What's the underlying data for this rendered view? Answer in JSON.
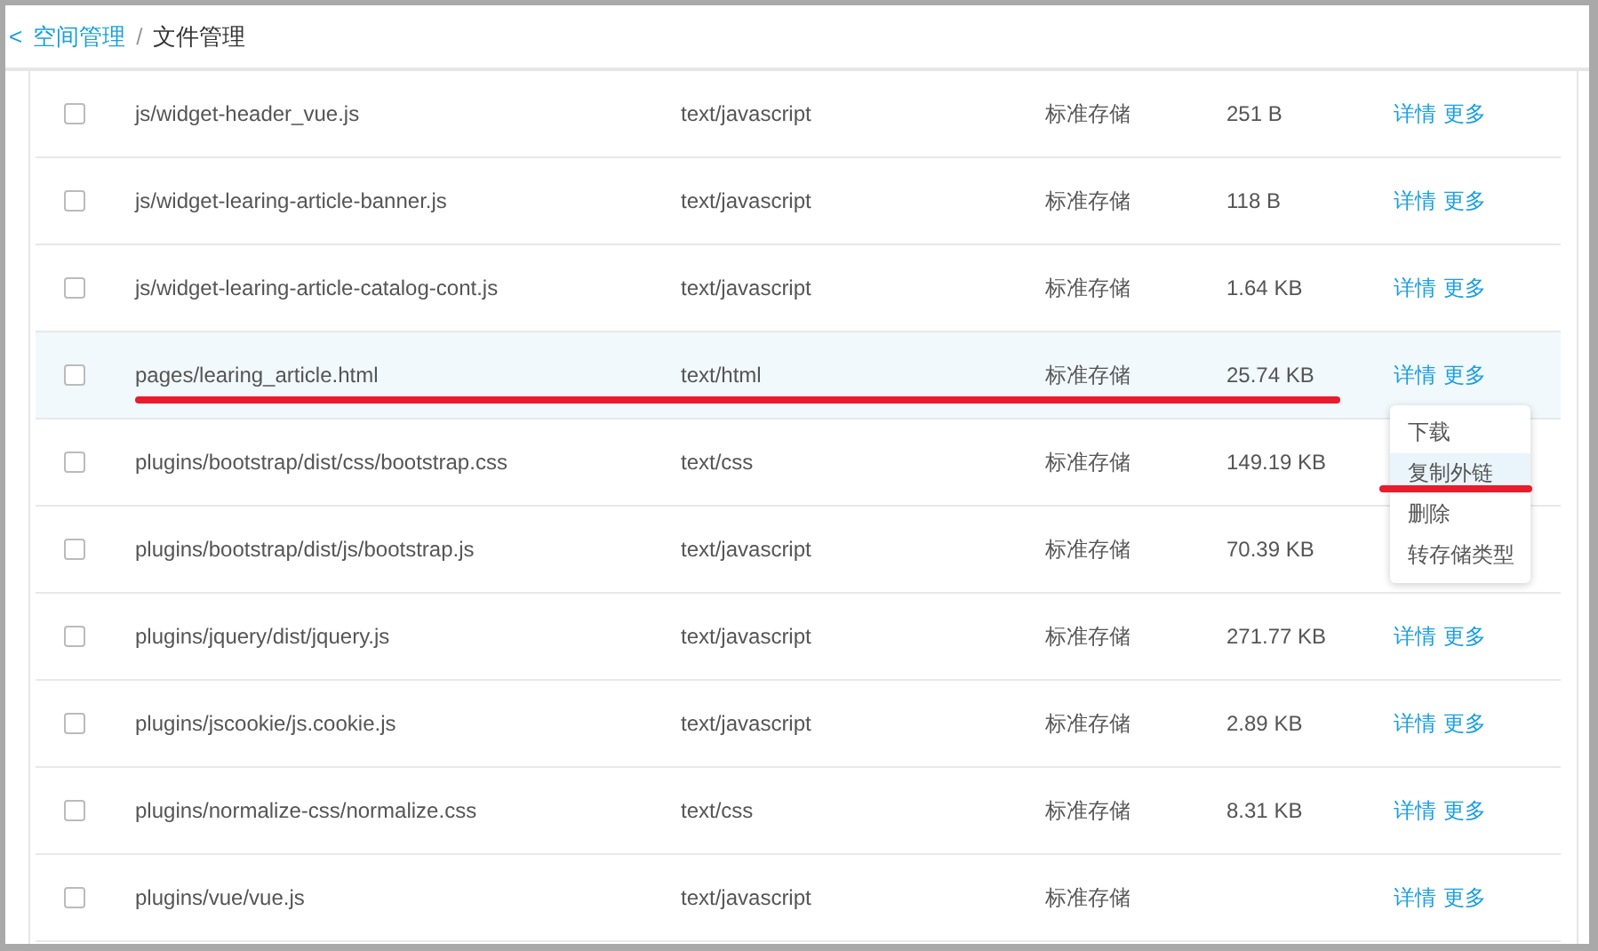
{
  "breadcrumb": {
    "back": "<",
    "items": [
      {
        "label": "空间管理",
        "link": true
      },
      {
        "label": "文件管理",
        "link": false
      }
    ],
    "separator": "/"
  },
  "rows": [
    {
      "checked": false,
      "selected": false,
      "underlined": false,
      "name": "js/widget-header_vue.js",
      "type": "text/javascript",
      "storage": "标准存储",
      "size": "251 B",
      "actions": [
        "详情",
        "更多"
      ]
    },
    {
      "checked": false,
      "selected": false,
      "underlined": false,
      "name": "js/widget-learing-article-banner.js",
      "type": "text/javascript",
      "storage": "标准存储",
      "size": "118 B",
      "actions": [
        "详情",
        "更多"
      ]
    },
    {
      "checked": false,
      "selected": false,
      "underlined": false,
      "name": "js/widget-learing-article-catalog-cont.js",
      "type": "text/javascript",
      "storage": "标准存储",
      "size": "1.64 KB",
      "actions": [
        "详情",
        "更多"
      ]
    },
    {
      "checked": false,
      "selected": true,
      "underlined": true,
      "name": "pages/learing_article.html",
      "type": "text/html",
      "storage": "标准存储",
      "size": "25.74 KB",
      "actions": [
        "详情",
        "更多"
      ]
    },
    {
      "checked": false,
      "selected": false,
      "underlined": false,
      "name": "plugins/bootstrap/dist/css/bootstrap.css",
      "type": "text/css",
      "storage": "标准存储",
      "size": "149.19 KB"
    },
    {
      "checked": false,
      "selected": false,
      "underlined": false,
      "name": "plugins/bootstrap/dist/js/bootstrap.js",
      "type": "text/javascript",
      "storage": "标准存储",
      "size": "70.39 KB"
    },
    {
      "checked": false,
      "selected": false,
      "underlined": false,
      "name": "plugins/jquery/dist/jquery.js",
      "type": "text/javascript",
      "storage": "标准存储",
      "size": "271.77 KB",
      "actions": [
        "详情",
        "更多"
      ]
    },
    {
      "checked": false,
      "selected": false,
      "underlined": false,
      "name": "plugins/jscookie/js.cookie.js",
      "type": "text/javascript",
      "storage": "标准存储",
      "size": "2.89 KB",
      "actions": [
        "详情",
        "更多"
      ]
    },
    {
      "checked": false,
      "selected": false,
      "underlined": false,
      "name": "plugins/normalize-css/normalize.css",
      "type": "text/css",
      "storage": "标准存储",
      "size": "8.31 KB",
      "actions": [
        "详情",
        "更多"
      ]
    },
    {
      "checked": false,
      "selected": false,
      "underlined": false,
      "name": "plugins/vue/vue.js",
      "type": "text/javascript",
      "storage": "标准存储",
      "actions": [
        "详情",
        "更多"
      ]
    }
  ],
  "menu": {
    "items": [
      {
        "label": "下载",
        "selected": false,
        "underlined": false
      },
      {
        "label": "复制外链",
        "selected": true,
        "underlined": true
      },
      {
        "label": "删除",
        "selected": false,
        "underlined": false
      },
      {
        "label": "转存储类型",
        "selected": false,
        "underlined": false
      }
    ]
  }
}
